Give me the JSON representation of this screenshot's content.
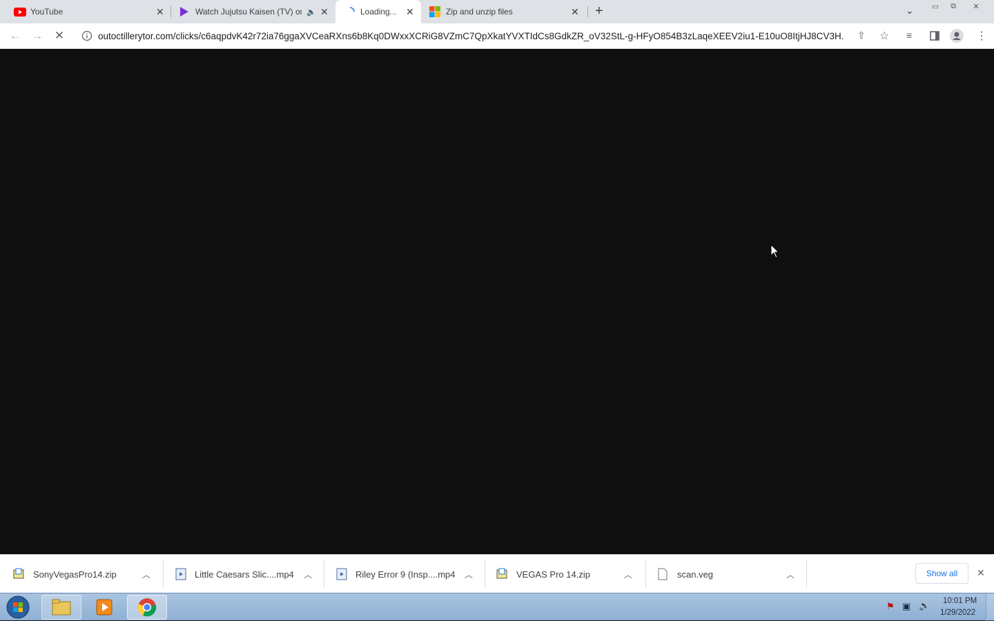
{
  "tabs": [
    {
      "title": "YouTube",
      "icon": "youtube-icon"
    },
    {
      "title": "Watch Jujutsu Kaisen (TV) on",
      "icon": "play-icon",
      "muted": true
    },
    {
      "title": "Loading...",
      "icon": "loading-icon",
      "active": true
    },
    {
      "title": "Zip and unzip files",
      "icon": "microsoft-icon"
    }
  ],
  "address_bar": {
    "url": "outoctillerytor.com/clicks/c6aqpdvK42r72ia76ggaXVCeaRXns6b8Kq0DWxxXCRiG8VZmC7QpXkatYVXTIdCs8GdkZR_oV32StL-g-HFyO854B3zLaqeXEEV2iu1-E10uO8ItjHJ8CV3H..."
  },
  "downloads": [
    {
      "name": "SonyVegasPro14.zip",
      "icon": "zip-file-icon"
    },
    {
      "name": "Little Caesars Slic....mp4",
      "icon": "video-file-icon"
    },
    {
      "name": "Riley Error 9 (Insp....mp4",
      "icon": "video-file-icon"
    },
    {
      "name": "VEGAS Pro 14.zip",
      "icon": "zip-file-icon"
    },
    {
      "name": "scan.veg",
      "icon": "file-icon"
    }
  ],
  "downloads_bar": {
    "show_all_label": "Show all"
  },
  "taskbar": {
    "time": "10:01 PM",
    "date": "1/29/2022"
  }
}
